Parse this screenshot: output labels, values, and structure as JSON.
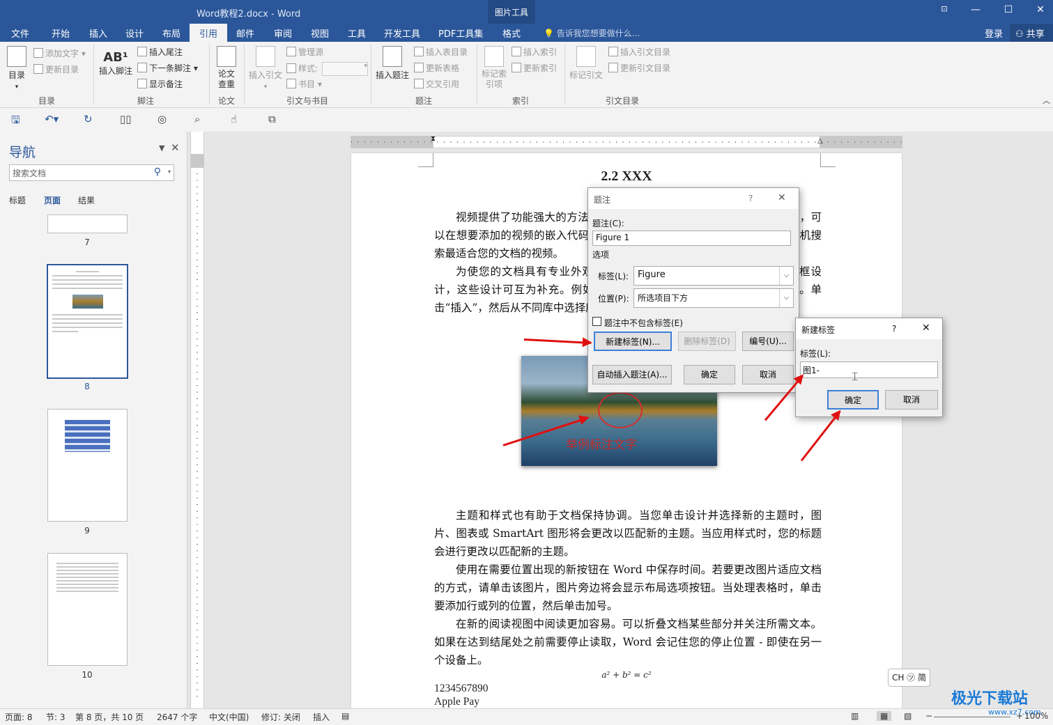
{
  "window": {
    "title": "Word教程2.docx - Word",
    "context_tab_group": "图片工具",
    "controls": [
      "⊡",
      "—",
      "☐",
      "✕"
    ]
  },
  "tabs": [
    "文件",
    "开始",
    "插入",
    "设计",
    "布局",
    "引用",
    "邮件",
    "审阅",
    "视图",
    "工具",
    "开发工具",
    "PDF工具集",
    "格式"
  ],
  "tell_me": "告诉我您想要做什么...",
  "account": {
    "login": "登录",
    "share": "共享"
  },
  "ribbon": {
    "toc": {
      "big": "目录",
      "add_text": "添加文字",
      "update_toc": "更新目录",
      "group": "目录"
    },
    "footnotes": {
      "insert_footnote": "插入脚注",
      "insert_endnote": "插入尾注",
      "next_footnote": "下一条脚注",
      "show_notes": "显示备注",
      "group": "脚注"
    },
    "paper": {
      "check": "论文查重",
      "group": "论文"
    },
    "citations": {
      "insert_citation": "插入引文",
      "manage_sources": "管理源",
      "style": "样式:",
      "bibliography": "书目",
      "group": "引文与书目"
    },
    "captions": {
      "insert_caption": "插入题注",
      "insert_table_of_figures": "插入表目录",
      "update_table": "更新表格",
      "cross_reference": "交叉引用",
      "group": "题注"
    },
    "index": {
      "mark_entry": "标记索引项",
      "insert_index": "插入索引",
      "update_index": "更新索引",
      "group": "索引"
    },
    "toa": {
      "mark_citation": "标记引文",
      "insert_toa": "插入引文目录",
      "update_toa": "更新引文目录",
      "group": "引文目录"
    }
  },
  "nav": {
    "title": "导航",
    "search_placeholder": "搜索文档",
    "tabs": [
      "标题",
      "页面",
      "结果"
    ],
    "pages": [
      "7",
      "8",
      "9",
      "10"
    ]
  },
  "document": {
    "heading": "2.2 XXX",
    "p1": "视频提供了功能强大的方法帮助您证明您的观点。当您单击联机视频时，可以在想要添加的视频的嵌入代码中进行粘贴。您也可以键入一个关键字以联机搜索最适合您的文档的视频。",
    "p2": "为使您的文档具有专业外观，Word 提供了页眉、页脚、封面和文本框设计，这些设计可互为补充。例如，您可以添加匹配的封面、页眉和提要栏。单击“插入”，然后从不同库中选择所需元素。",
    "image_caption": "举例标注文字",
    "p3": "主题和样式也有助于文档保持协调。当您单击设计并选择新的主题时，图片、图表或 SmartArt 图形将会更改以匹配新的主题。当应用样式时，您的标题会进行更改以匹配新的主题。",
    "p4": "使用在需要位置出现的新按钮在 Word 中保存时间。若要更改图片适应文档的方式，请单击该图片，图片旁边将会显示布局选项按钮。当处理表格时，单击要添加行或列的位置，然后单击加号。",
    "p5": "在新的阅读视图中阅读更加容易。可以折叠文档某些部分并关注所需文本。如果在达到结尾处之前需要停止读取，Word 会记住您的停止位置 - 即使在另一个设备上。",
    "formula": "a² + b² = c²",
    "line1": "1234567890",
    "line2": "Apple Pay"
  },
  "caption_dialog": {
    "title": "题注",
    "help": "?",
    "close": "✕",
    "caption_label": "题注(C):",
    "caption_value": "Figure 1",
    "options": "选项",
    "label_label": "标签(L):",
    "label_value": "Figure",
    "position_label": "位置(P):",
    "position_value": "所选项目下方",
    "exclude_label": "题注中不包含标签(E)",
    "new_label": "新建标签(N)...",
    "delete_label": "删除标签(D)",
    "numbering": "编号(U)...",
    "autocaption": "自动插入题注(A)...",
    "ok": "确定",
    "cancel": "取消"
  },
  "new_label_dialog": {
    "title": "新建标签",
    "help": "?",
    "close": "✕",
    "label_label": "标签(L):",
    "label_value": "图1-",
    "ok": "确定",
    "cancel": "取消"
  },
  "status": {
    "page": "页面: 8",
    "section": "节: 3",
    "page_of": "第 8 页，共 10 页",
    "words": "2647 个字",
    "language": "中文(中国)",
    "revisions": "修订: 关闭",
    "insert": "插入",
    "zoom": "100%"
  },
  "ime": "CH ㋡ 简",
  "watermark": {
    "brand": "极光下载站",
    "url": "www.xz7.com"
  },
  "colors": {
    "accent": "#2b579a",
    "annotation": "#e01010",
    "focus": "#3c7fd8"
  }
}
